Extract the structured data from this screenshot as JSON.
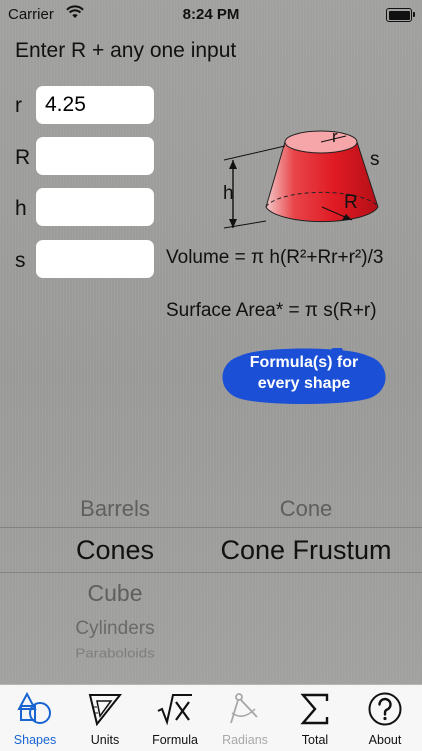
{
  "status": {
    "carrier": "Carrier",
    "time": "8:24 PM"
  },
  "instruction": "Enter R + any one input",
  "inputs": [
    {
      "label": "r",
      "value": "4.25"
    },
    {
      "label": "R",
      "value": ""
    },
    {
      "label": "h",
      "value": ""
    },
    {
      "label": "s",
      "value": ""
    }
  ],
  "diagram": {
    "r": "r",
    "R": "R",
    "h": "h",
    "s": "s"
  },
  "formulas": {
    "volume": "Volume = π h(R²+Rr+r²)/3",
    "surface": "Surface Area* = π s(R+r)"
  },
  "bubble": {
    "line1": "Formula(s) for",
    "line2": "every shape"
  },
  "picker": {
    "categories": [
      "Barrels",
      "Cones",
      "Cube",
      "Cylinders",
      "Paraboloids"
    ],
    "shapes": [
      "Cone",
      "Cone Frustum"
    ]
  },
  "tabs": [
    {
      "label": "Shapes"
    },
    {
      "label": "Units"
    },
    {
      "label": "Formula"
    },
    {
      "label": "Radians"
    },
    {
      "label": "Total"
    },
    {
      "label": "About"
    }
  ],
  "colors": {
    "accent": "#1a64d2",
    "bubble": "#1b4fd6",
    "shape_red": "#e01b24",
    "disabled": "#a8a8a8"
  }
}
